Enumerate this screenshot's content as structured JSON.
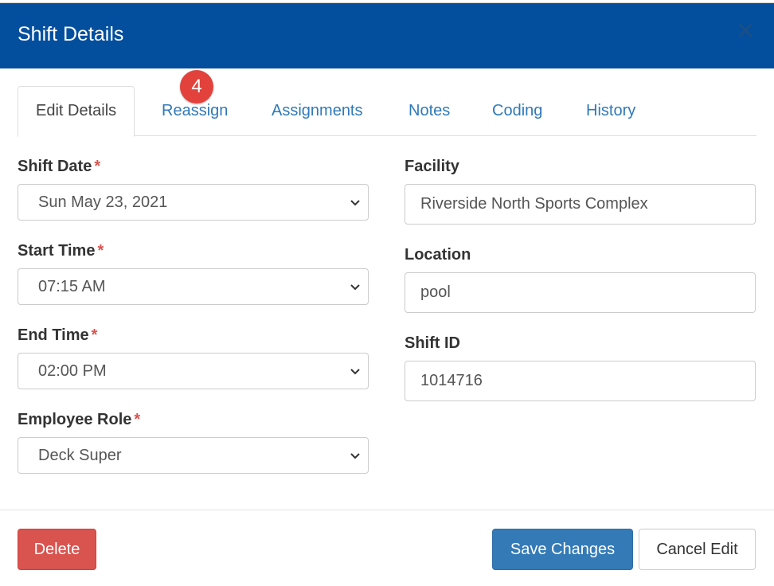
{
  "modal": {
    "title": "Shift Details",
    "close_icon": "close-icon"
  },
  "tabs": [
    {
      "label": "Edit Details",
      "active": true
    },
    {
      "label": "Reassign",
      "badge": "4"
    },
    {
      "label": "Assignments"
    },
    {
      "label": "Notes"
    },
    {
      "label": "Coding"
    },
    {
      "label": "History"
    }
  ],
  "form": {
    "required_mark": "*",
    "shift_date": {
      "label": "Shift Date",
      "value": "Sun May 23, 2021"
    },
    "start_time": {
      "label": "Start Time",
      "value": "07:15 AM"
    },
    "end_time": {
      "label": "End Time",
      "value": "02:00 PM"
    },
    "employee_role": {
      "label": "Employee Role",
      "value": "Deck Super"
    },
    "facility": {
      "label": "Facility",
      "value": "Riverside North Sports Complex"
    },
    "location": {
      "label": "Location",
      "value": "pool"
    },
    "shift_id": {
      "label": "Shift ID",
      "value": "1014716"
    }
  },
  "footer": {
    "delete_label": "Delete",
    "save_label": "Save Changes",
    "cancel_label": "Cancel Edit"
  },
  "colors": {
    "header_bg": "#034f9e",
    "tab_link": "#2f79b8",
    "danger": "#d9534f",
    "primary": "#337ab7",
    "badge": "#e2413c"
  }
}
